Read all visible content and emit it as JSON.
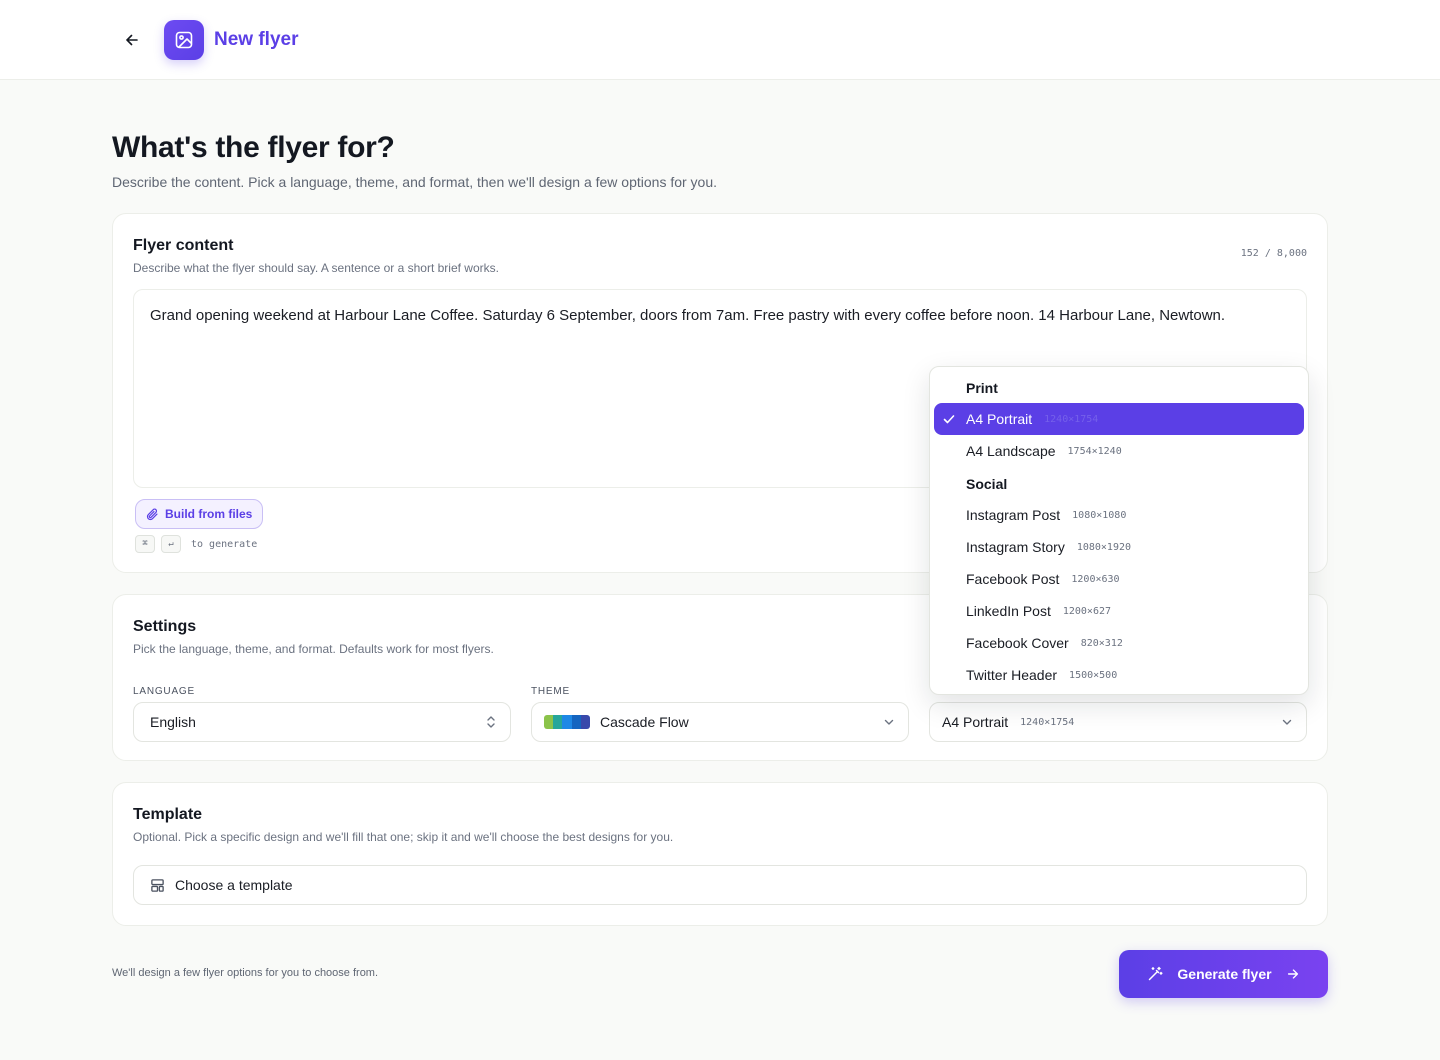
{
  "header": {
    "title": "New flyer"
  },
  "page": {
    "heading": "What's the flyer for?",
    "subheading": "Describe the content. Pick a language, theme, and format, then we'll design a few options for you."
  },
  "content_card": {
    "title": "Flyer content",
    "description": "Describe what the flyer should say. A sentence or a short brief works.",
    "counter": "152 / 8,000",
    "text": "Grand opening weekend at Harbour Lane Coffee. Saturday 6 September, doors from 7am. Free pastry with every coffee before noon. 14 Harbour Lane, Newtown.",
    "build_button": "Build from files",
    "shortcut_key_1": "⌘",
    "shortcut_key_2": "↵",
    "shortcut_hint": "to generate"
  },
  "settings": {
    "title": "Settings",
    "description": "Pick the language, theme, and format. Defaults work for most flyers.",
    "language_label": "Language",
    "language_value": "English",
    "theme_label": "Theme",
    "theme_value": "Cascade Flow",
    "theme_swatch": [
      "#8bc34a",
      "#26a69a",
      "#1e88e5",
      "#1565c0",
      "#3949ab"
    ],
    "format_value": "A4 Portrait",
    "format_dims": "1240×1754"
  },
  "format_dropdown": {
    "groups": [
      {
        "label": "Print",
        "items": [
          {
            "label": "A4 Portrait",
            "dims": "1240×1754",
            "selected": true
          },
          {
            "label": "A4 Landscape",
            "dims": "1754×1240"
          }
        ]
      },
      {
        "label": "Social",
        "items": [
          {
            "label": "Instagram Post",
            "dims": "1080×1080"
          },
          {
            "label": "Instagram Story",
            "dims": "1080×1920"
          },
          {
            "label": "Facebook Post",
            "dims": "1200×630"
          },
          {
            "label": "LinkedIn Post",
            "dims": "1200×627"
          },
          {
            "label": "Facebook Cover",
            "dims": "820×312"
          },
          {
            "label": "Twitter Header",
            "dims": "1500×500"
          }
        ]
      }
    ]
  },
  "template": {
    "title": "Template",
    "description": "Optional. Pick a specific design and we'll fill that one; skip it and we'll choose the best designs for you.",
    "button": "Choose a template"
  },
  "footer": {
    "note": "We'll design a few flyer options for you to choose from.",
    "generate_button": "Generate flyer"
  },
  "colors": {
    "accent": "#5b3fe6",
    "background": "#f9faf8"
  }
}
